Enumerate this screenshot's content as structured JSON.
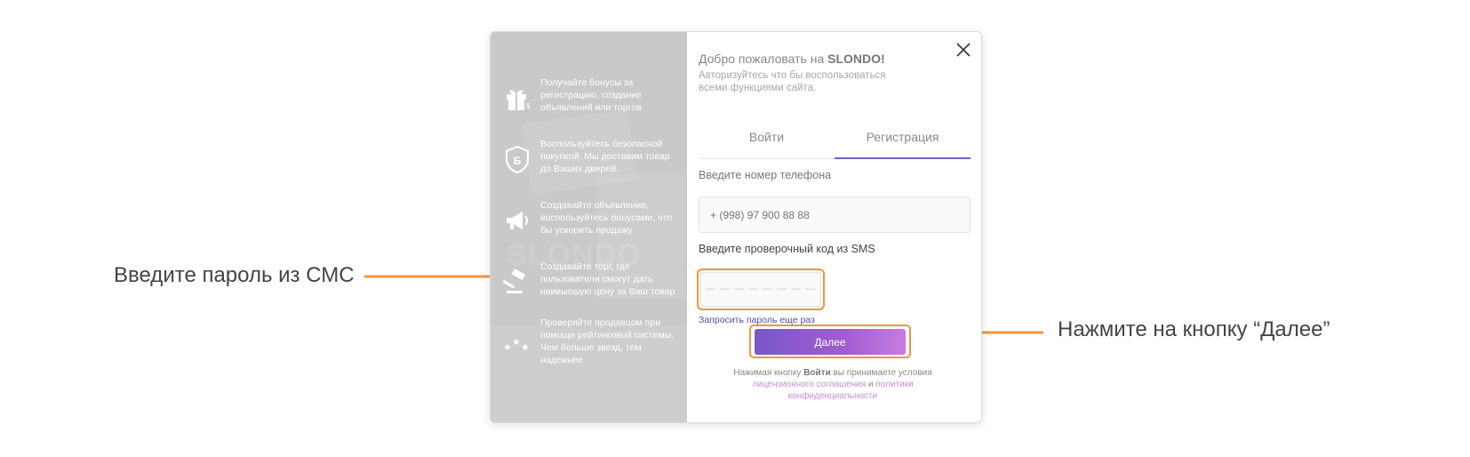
{
  "features": [
    {
      "icon": "gift-icon",
      "text": "Получайте бонусы за регистрацию, создание объявлений или торгов"
    },
    {
      "icon": "shield-icon",
      "glyph": "Б",
      "text": "Воспользуйтесь безопасной покупкой. Мы доставим товар до Ваших дверей."
    },
    {
      "icon": "megaphone-icon",
      "text": "Создавайте объявления, воспользуйтесь бонусами, что бы ускорить продажу"
    },
    {
      "icon": "gavel-icon",
      "text": "Создавайте торг, где пользователи смогут дать наивысшую цену за Ваш товар"
    },
    {
      "icon": "stars-icon",
      "text": "Проверяйте продавцом при помощи рейтинговой системы. Чем больше звезд, тем надежнее"
    }
  ],
  "background_logo": "SLONDO",
  "header": {
    "welcome_prefix": "Добро пожаловать на ",
    "brand": "SLONDO!",
    "subtitle": "Авторизуйтесь что бы воспользоваться всеми функциями сайта."
  },
  "tabs": {
    "login": "Войти",
    "register": "Регистрация",
    "active": "register"
  },
  "form": {
    "phone_label": "Введите номер телефона",
    "phone_placeholder": "+ (998) 97 900 88 88",
    "sms_label": "Введите проверочный код из SMS",
    "sms_placeholder": "— — — — — — — —",
    "resend_link": "Запросить пароль еще раз",
    "next_button": "Далее"
  },
  "terms": {
    "prefix": "Нажимая кнопку ",
    "button_name": "Войти",
    "middle": " вы принимаете условия ",
    "license_link": "лицензионного соглашения",
    "and": " и ",
    "privacy_link": "политики конфиденциальности"
  },
  "annotations": {
    "left": "Введите пароль из СМС",
    "right": "Нажмите на кнопку “Далее”"
  },
  "colors": {
    "accent": "#7a5ec4",
    "highlight": "#f0963a",
    "button_gradient_start": "#7a58c8",
    "button_gradient_end": "#c77ce0",
    "left_panel": "#c9c9c9"
  }
}
